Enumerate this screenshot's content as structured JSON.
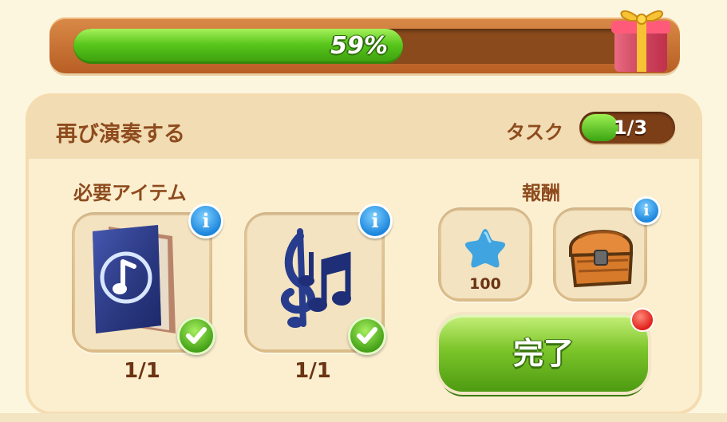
{
  "progress": {
    "value_percent": 59,
    "label": "59%"
  },
  "panel": {
    "title": "再び演奏する",
    "task": {
      "label": "タスク",
      "count": "1/3",
      "fraction": 0.333
    }
  },
  "required": {
    "label": "必要アイテム",
    "items": [
      {
        "icon": "music-book-icon",
        "count": "1/1",
        "info": "i",
        "completed": true
      },
      {
        "icon": "music-notes-icon",
        "count": "1/1",
        "info": "i",
        "completed": true
      }
    ]
  },
  "rewards": {
    "label": "報酬",
    "items": [
      {
        "icon": "blue-star-icon",
        "count": "100"
      },
      {
        "icon": "treasure-chest-icon",
        "info": "i"
      }
    ]
  },
  "complete_button": {
    "label": "完了",
    "has_notification": true
  },
  "colors": {
    "accent_green": "#58c61b",
    "brown_text": "#8e4b1d",
    "info_blue": "#1c86dd",
    "notification_red": "#e0201a"
  }
}
